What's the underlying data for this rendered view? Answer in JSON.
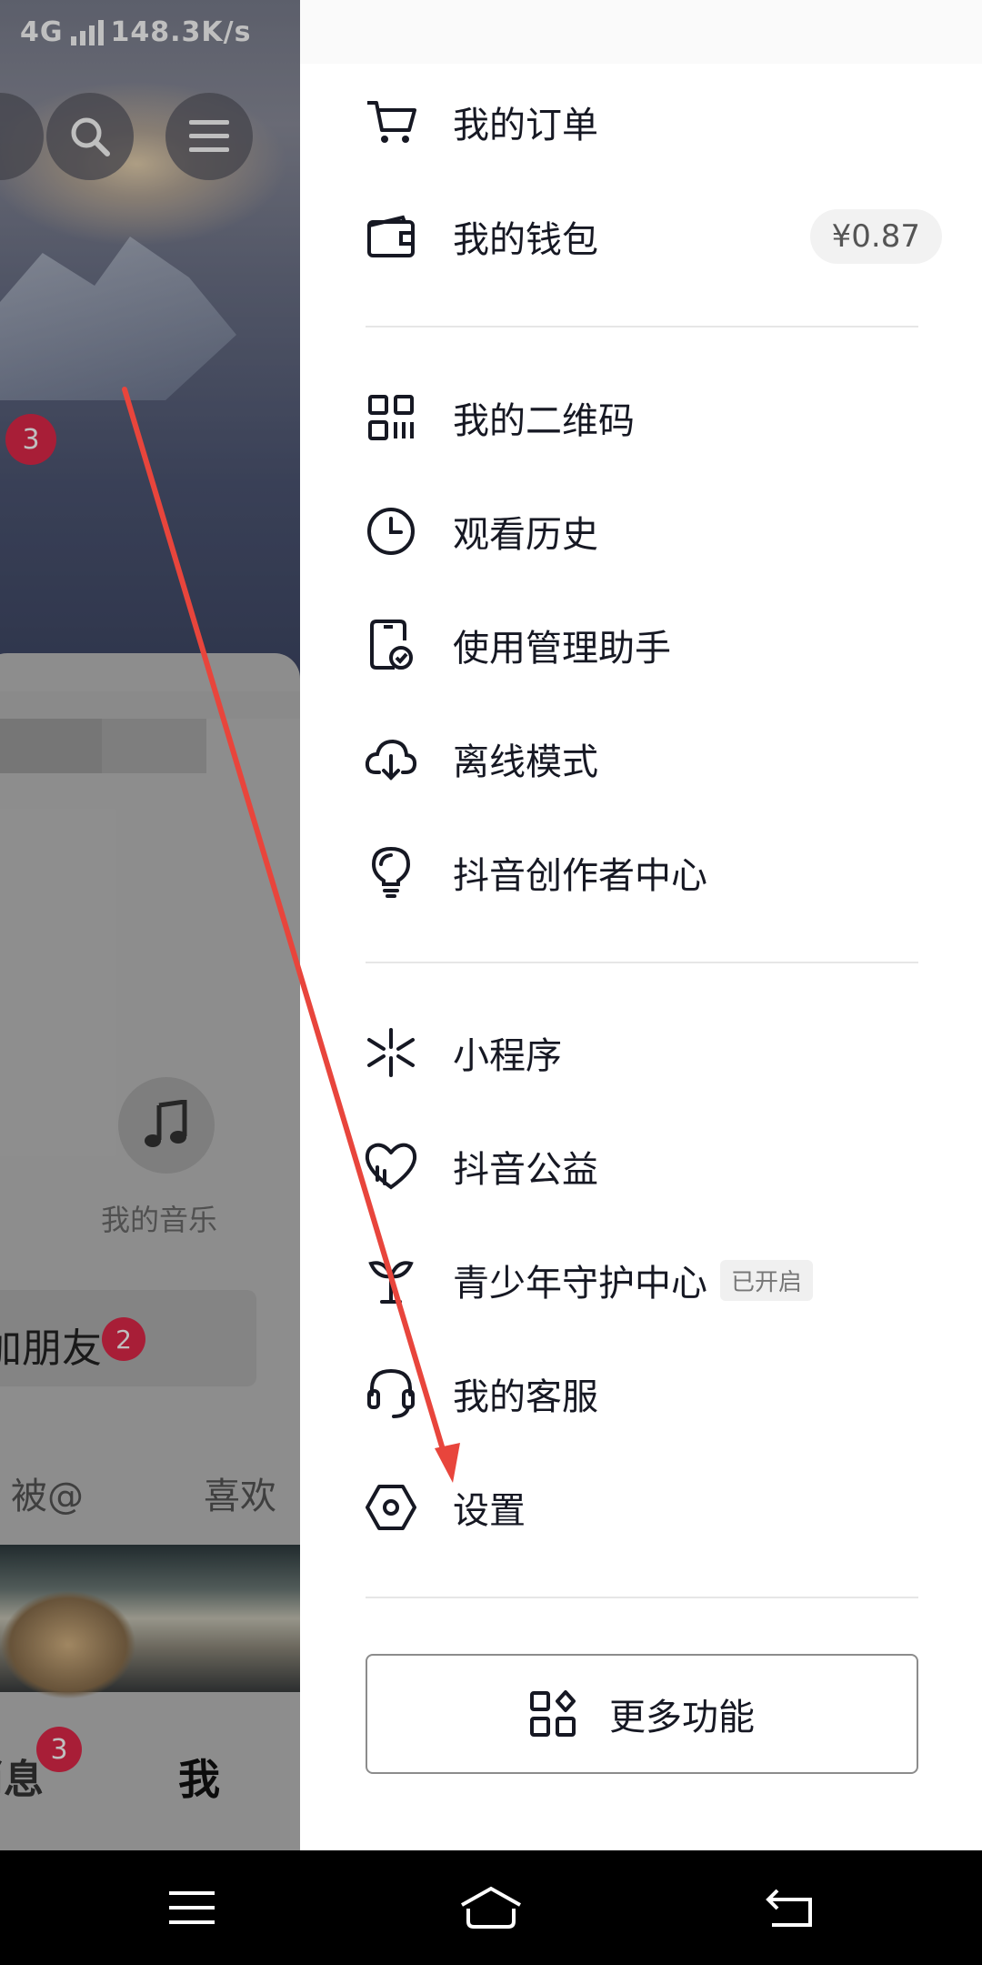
{
  "status_bar": {
    "network": "4G",
    "speed": "148.3K/s"
  },
  "left_panel": {
    "badge_top": "3",
    "music_label": "我的音乐",
    "friends_label": "加朋友",
    "friends_badge": "2",
    "tab_mentions": "被@",
    "tab_likes": "喜欢",
    "bottom_messages": "消息",
    "bottom_messages_badge": "3",
    "bottom_me": "我"
  },
  "drawer": {
    "items": [
      {
        "label": "我的订单",
        "icon": "cart-icon"
      },
      {
        "label": "我的钱包",
        "icon": "wallet-icon",
        "value": "¥0.87"
      },
      {
        "label": "我的二维码",
        "icon": "qrcode-icon"
      },
      {
        "label": "观看历史",
        "icon": "clock-icon"
      },
      {
        "label": "使用管理助手",
        "icon": "phone-check-icon"
      },
      {
        "label": "离线模式",
        "icon": "cloud-download-icon"
      },
      {
        "label": "抖音创作者中心",
        "icon": "lightbulb-icon"
      },
      {
        "label": "小程序",
        "icon": "mini-program-icon"
      },
      {
        "label": "抖音公益",
        "icon": "heart-charity-icon"
      },
      {
        "label": "青少年守护中心",
        "icon": "sprout-icon",
        "tag": "已开启"
      },
      {
        "label": "我的客服",
        "icon": "headset-icon"
      },
      {
        "label": "设置",
        "icon": "settings-hexagon-icon"
      }
    ],
    "more_button": "更多功能"
  },
  "colors": {
    "accent_red": "#e0294a",
    "arrow_red": "#e8453c",
    "text": "#161823"
  }
}
